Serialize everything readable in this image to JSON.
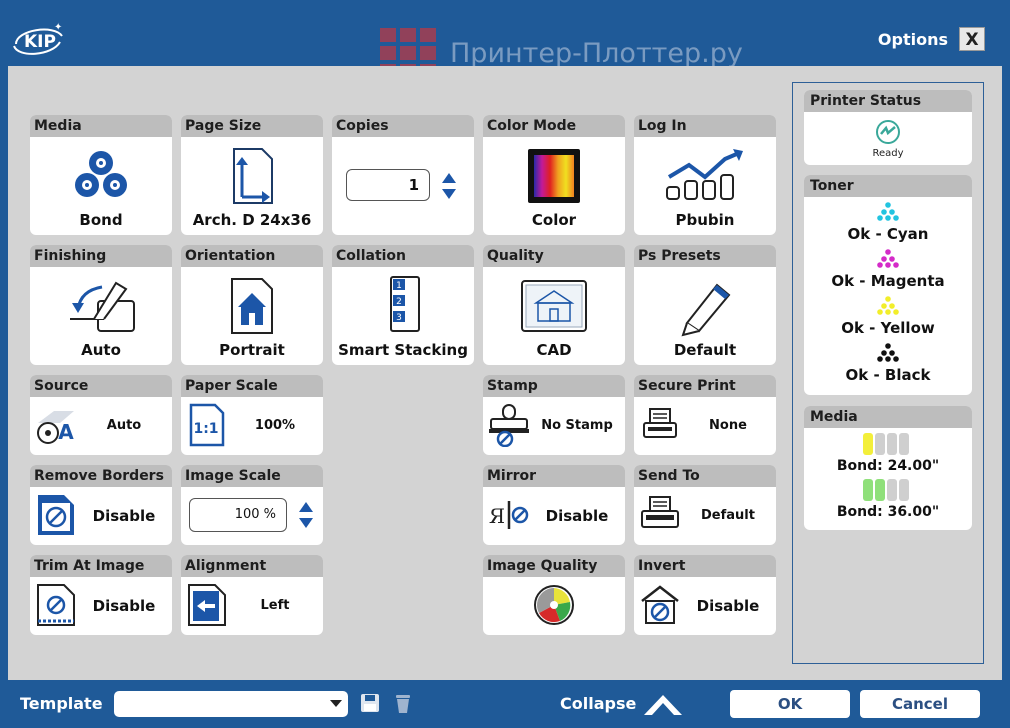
{
  "window": {
    "logo_text": "KIP",
    "watermark": "Принтер-Плоттер.ру",
    "options_label": "Options",
    "close_label": "X"
  },
  "tiles": {
    "media": {
      "title": "Media",
      "value": "Bond"
    },
    "page_size": {
      "title": "Page Size",
      "value": "Arch. D 24x36"
    },
    "copies": {
      "title": "Copies",
      "value": "1"
    },
    "color_mode": {
      "title": "Color Mode",
      "value": "Color"
    },
    "log_in": {
      "title": "Log In",
      "value": "Pbubin"
    },
    "finishing": {
      "title": "Finishing",
      "value": "Auto"
    },
    "orientation": {
      "title": "Orientation",
      "value": "Portrait"
    },
    "collation": {
      "title": "Collation",
      "value": "Smart Stacking"
    },
    "quality": {
      "title": "Quality",
      "value": "CAD"
    },
    "ps_presets": {
      "title": "Ps Presets",
      "value": "Default"
    },
    "source": {
      "title": "Source",
      "value": "Auto"
    },
    "paper_scale": {
      "title": "Paper Scale",
      "value": "100%"
    },
    "stamp": {
      "title": "Stamp",
      "value": "No Stamp"
    },
    "secure_print": {
      "title": "Secure Print",
      "value": "None"
    },
    "remove_borders": {
      "title": "Remove Borders",
      "value": "Disable"
    },
    "image_scale": {
      "title": "Image Scale",
      "value": "100 %"
    },
    "mirror": {
      "title": "Mirror",
      "value": "Disable"
    },
    "send_to": {
      "title": "Send To",
      "value": "Default"
    },
    "trim_at_image": {
      "title": "Trim At Image",
      "value": "Disable"
    },
    "alignment": {
      "title": "Alignment",
      "value": "Left"
    },
    "image_quality": {
      "title": "Image Quality",
      "value": ""
    },
    "invert": {
      "title": "Invert",
      "value": "Disable"
    }
  },
  "icons": {
    "paper_scale_glyph": "1:1",
    "source_glyph": "A",
    "mirror_glyph": "Я",
    "collation_numbers": [
      "1",
      "2",
      "3"
    ]
  },
  "sidebar": {
    "printer_status": {
      "title": "Printer Status",
      "status": "Ready"
    },
    "toner": {
      "title": "Toner",
      "items": [
        {
          "label": "Ok - Cyan",
          "color": "#22c4e0"
        },
        {
          "label": "Ok - Magenta",
          "color": "#d42bc8"
        },
        {
          "label": "Ok - Yellow",
          "color": "#f2ee2a"
        },
        {
          "label": "Ok - Black",
          "color": "#111111"
        }
      ]
    },
    "media": {
      "title": "Media",
      "rolls": [
        {
          "label": "Bond: 24.00\"",
          "color": "#f3ef3a",
          "level": 0.25
        },
        {
          "label": "Bond: 36.00\"",
          "color": "#8fe07a",
          "level": 0.5
        }
      ]
    }
  },
  "bottom": {
    "template_label": "Template",
    "template_value": "",
    "collapse_label": "Collapse",
    "ok_label": "OK",
    "cancel_label": "Cancel"
  },
  "colors": {
    "frame": "#1f5a98",
    "panel": "#d3d3d3",
    "tile_header": "#bdbdbd",
    "icon_blue": "#1c56a8"
  }
}
